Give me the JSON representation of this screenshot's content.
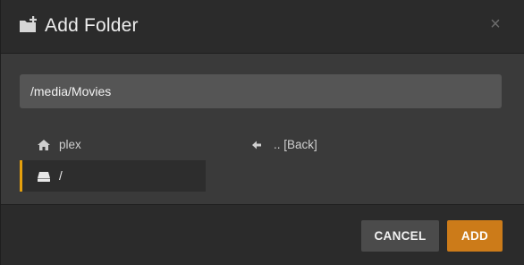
{
  "dialog": {
    "title": "Add Folder",
    "close_label": "×"
  },
  "path_input": {
    "value": "/media/Movies"
  },
  "browser": {
    "home_label": "plex",
    "back_label": ".. [Back]",
    "root_label": "/"
  },
  "footer": {
    "cancel_label": "CANCEL",
    "add_label": "ADD"
  },
  "colors": {
    "accent": "#e5a00d",
    "add_button": "#cc7b19"
  },
  "icons": {
    "header": "folder-add-icon",
    "home": "home-icon",
    "back": "arrow-left-icon",
    "root": "drive-icon"
  }
}
